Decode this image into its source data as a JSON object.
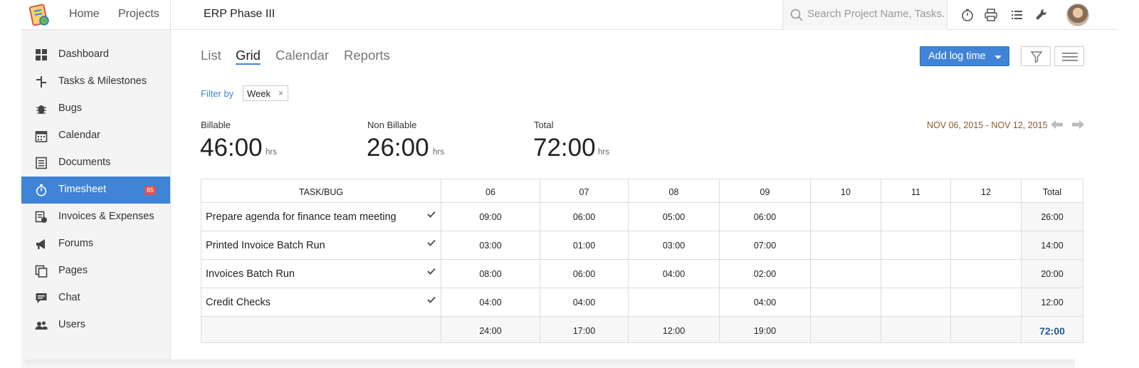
{
  "topbar": {
    "nav": [
      "Home",
      "Projects"
    ],
    "project_title": "ERP Phase III",
    "search_placeholder": "Search Project Name, Tasks..."
  },
  "sidebar": {
    "items": [
      {
        "label": "Dashboard",
        "icon": "dashboard-icon"
      },
      {
        "label": "Tasks & Milestones",
        "icon": "tasks-icon"
      },
      {
        "label": "Bugs",
        "icon": "bug-icon"
      },
      {
        "label": "Calendar",
        "icon": "calendar-icon"
      },
      {
        "label": "Documents",
        "icon": "document-icon"
      },
      {
        "label": "Timesheet",
        "icon": "stopwatch-icon",
        "badge": "85",
        "active": true
      },
      {
        "label": "Invoices & Expenses",
        "icon": "invoice-icon"
      },
      {
        "label": "Forums",
        "icon": "megaphone-icon"
      },
      {
        "label": "Pages",
        "icon": "pages-icon"
      },
      {
        "label": "Chat",
        "icon": "chat-icon"
      },
      {
        "label": "Users",
        "icon": "users-icon"
      }
    ]
  },
  "tabs": [
    "List",
    "Grid",
    "Calendar",
    "Reports"
  ],
  "active_tab": "Grid",
  "add_button": "Add log time",
  "filter": {
    "label": "Filter by",
    "chip": "Week",
    "chip_close": "×"
  },
  "stats": {
    "billable": {
      "label": "Billable",
      "value": "46:00",
      "unit": "hrs"
    },
    "non_billable": {
      "label": "Non Billable",
      "value": "26:00",
      "unit": "hrs"
    },
    "total": {
      "label": "Total",
      "value": "72:00",
      "unit": "hrs"
    }
  },
  "date_range": "NOV 06, 2015 - NOV 12, 2015",
  "grid": {
    "headers": [
      "TASK/BUG",
      "06",
      "07",
      "08",
      "09",
      "10",
      "11",
      "12",
      "Total"
    ],
    "rows": [
      {
        "task": "Prepare agenda for finance team meeting",
        "cells": [
          "09:00",
          "06:00",
          "05:00",
          "06:00",
          "",
          "",
          ""
        ],
        "total": "26:00"
      },
      {
        "task": "Printed Invoice Batch Run",
        "cells": [
          "03:00",
          "01:00",
          "03:00",
          "07:00",
          "",
          "",
          ""
        ],
        "total": "14:00"
      },
      {
        "task": "Invoices Batch Run",
        "cells": [
          "08:00",
          "06:00",
          "04:00",
          "02:00",
          "",
          "",
          ""
        ],
        "total": "20:00"
      },
      {
        "task": "Credit Checks",
        "cells": [
          "04:00",
          "04:00",
          "",
          "04:00",
          "",
          "",
          ""
        ],
        "total": "12:00"
      }
    ],
    "day_totals": [
      "24:00",
      "17:00",
      "12:00",
      "19:00",
      "",
      "",
      ""
    ],
    "grand_total": "72:00"
  },
  "colors": {
    "accent": "#3f84d6",
    "badge": "#d9534f",
    "date_range": "#8a5a2b"
  }
}
